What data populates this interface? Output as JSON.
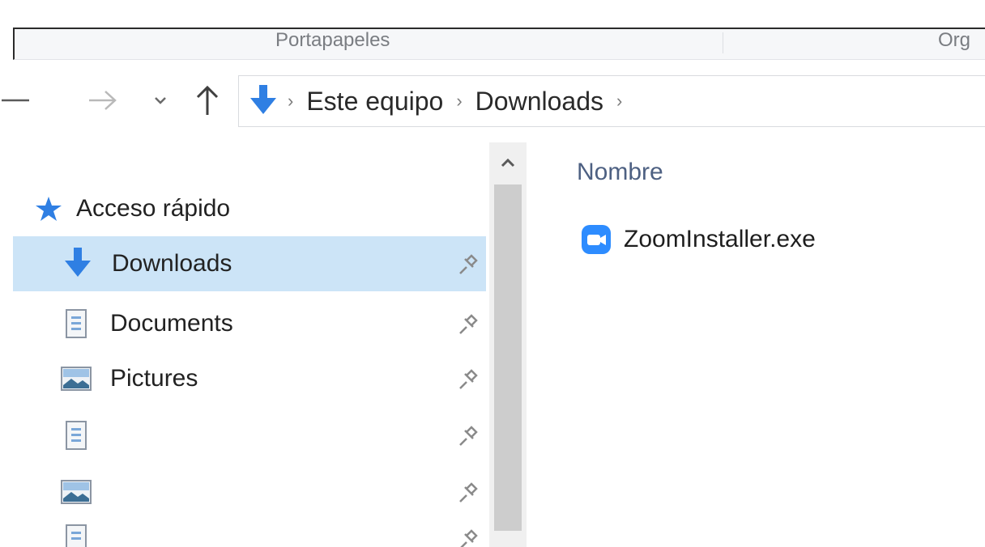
{
  "ribbon": {
    "groups": [
      "Portapapeles",
      "Org"
    ]
  },
  "navigation": {
    "back_icon": "arrow-left-icon",
    "forward_icon": "arrow-right-icon",
    "recent_icon": "chevron-down-icon",
    "up_icon": "arrow-up-icon"
  },
  "address": {
    "location_icon": "downloads-arrow-icon",
    "crumbs": [
      "Este equipo",
      "Downloads"
    ]
  },
  "sidebar": {
    "quick_access": "Acceso rápido",
    "items": [
      {
        "label": "Downloads",
        "icon": "downloads-icon",
        "selected": true
      },
      {
        "label": "Documents",
        "icon": "document-icon",
        "selected": false
      },
      {
        "label": "Pictures",
        "icon": "pictures-icon",
        "selected": false
      },
      {
        "label": "",
        "icon": "document-icon",
        "selected": false
      },
      {
        "label": "",
        "icon": "pictures-icon",
        "selected": false
      },
      {
        "label": "",
        "icon": "document-icon",
        "selected": false
      }
    ]
  },
  "content": {
    "column_name": "Nombre",
    "files": [
      {
        "name": "ZoomInstaller.exe",
        "icon": "zoom-app-icon"
      }
    ]
  },
  "colors": {
    "accent_blue": "#2f7fe3",
    "selection": "#cce4f7",
    "zoom_blue": "#2d8cff"
  }
}
